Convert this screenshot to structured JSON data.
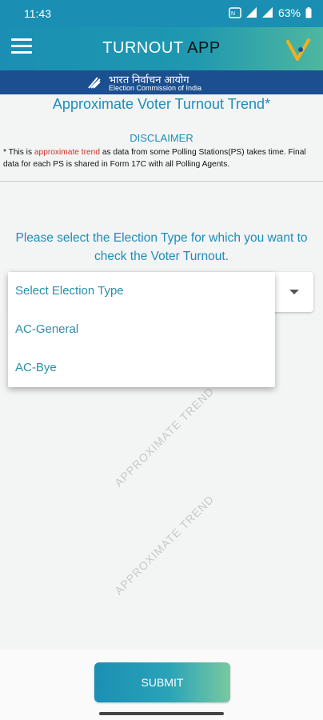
{
  "status_bar": {
    "time": "11:43",
    "battery": "63%",
    "icons": [
      "nfc-icon",
      "wifi-icon",
      "signal-icon",
      "battery-icon"
    ]
  },
  "app_bar": {
    "title_part1": "TURNOUT",
    "title_part2": "APP",
    "menu_icon": "hamburger-menu-icon",
    "logo_icon": "v-logo-icon"
  },
  "eci_banner": {
    "hindi": "भारत निर्वाचन आयोग",
    "english": "Election Commission of India"
  },
  "heading": "Approximate Voter Turnout Trend*",
  "disclaimer": {
    "title": "DISCLAIMER",
    "prefix": "* This is ",
    "highlight": "approximate trend",
    "suffix": " as data from some Polling Stations(PS) takes time. Final data for each PS is shared in Form 17C with all Polling Agents."
  },
  "prompt": "Please select the Election Type for which you want to check the Voter Turnout.",
  "election_select": {
    "selected": "Select Election Type",
    "options": [
      "Select Election Type",
      "AC-General",
      "AC-Bye"
    ]
  },
  "watermark": "APPROXIMATE TREND",
  "submit_label": "SUBMIT",
  "colors": {
    "primary": "#1b8fb3",
    "banner": "#1b4f8f",
    "accent_red": "#d0332a",
    "option_text": "#2a8eaa"
  }
}
